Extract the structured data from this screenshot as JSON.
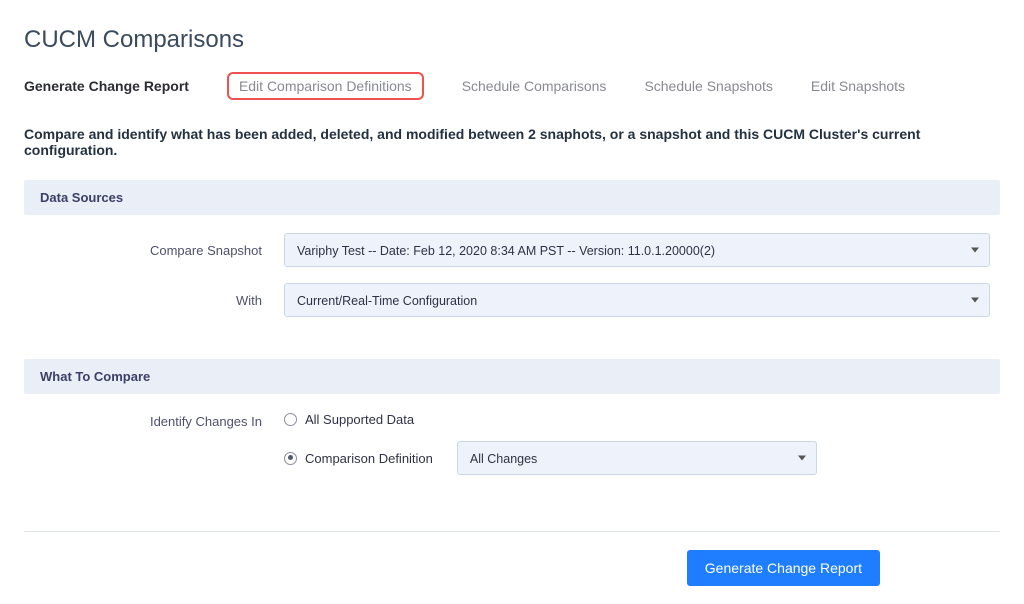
{
  "page": {
    "title": "CUCM Comparisons",
    "description": "Compare and identify what has been added, deleted, and modified between 2 snaphots, or a snapshot and this CUCM Cluster's current configuration."
  },
  "tabs": {
    "items": [
      {
        "label": "Generate Change Report",
        "active": true
      },
      {
        "label": "Edit Comparison Definitions",
        "highlight": true
      },
      {
        "label": "Schedule Comparisons"
      },
      {
        "label": "Schedule Snapshots"
      },
      {
        "label": "Edit Snapshots"
      }
    ]
  },
  "sections": {
    "dataSources": {
      "header": "Data Sources",
      "compare_label": "Compare Snapshot",
      "compare_value": "Variphy Test -- Date: Feb 12, 2020 8:34 AM PST -- Version: 11.0.1.20000(2)",
      "with_label": "With",
      "with_value": "Current/Real-Time Configuration"
    },
    "whatToCompare": {
      "header": "What To Compare",
      "identify_label": "Identify Changes In",
      "options": {
        "all_supported": "All Supported Data",
        "comparison_definition": "Comparison Definition",
        "selected": "comparison_definition"
      },
      "definition_value": "All Changes"
    }
  },
  "actions": {
    "generate": "Generate Change Report"
  }
}
